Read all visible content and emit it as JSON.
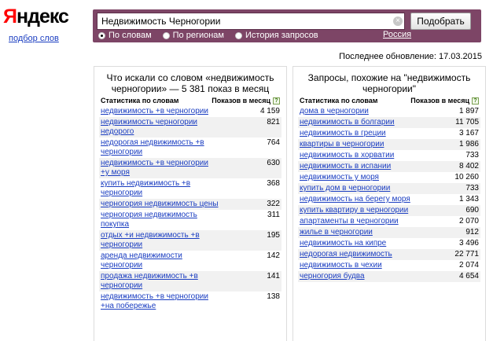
{
  "logo": {
    "first_letter": "Я",
    "rest": "ндекс"
  },
  "service_link": "подбор слов",
  "search": {
    "value": "Недвижимость Черногории",
    "placeholder": "",
    "submit_label": "Подобрать",
    "modes": [
      {
        "label": "По словам",
        "checked": true
      },
      {
        "label": "По регионам",
        "checked": false
      },
      {
        "label": "История запросов",
        "checked": false
      }
    ],
    "region_label": "Россия"
  },
  "updated": "Последнее обновление: 17.03.2015",
  "left_panel": {
    "title": "Что искали со словом «недвижимость черногории» — 5 381 показ в месяц",
    "col_query": "Статистика по словам",
    "col_shows": "Показов в месяц",
    "help_icon": "?",
    "rows": [
      {
        "query": "недвижимость +в черногории",
        "count": "4 159"
      },
      {
        "query": "недвижимость черногории недорого",
        "count": "821"
      },
      {
        "query": "недорогая недвижимость +в черногории",
        "count": "764"
      },
      {
        "query": "недвижимость +в черногории +у моря",
        "count": "630"
      },
      {
        "query": "купить недвижимость +в черногории",
        "count": "368"
      },
      {
        "query": "черногория недвижимость цены",
        "count": "322"
      },
      {
        "query": "черногория недвижимость покупка",
        "count": "311"
      },
      {
        "query": "отдых +и недвижимость +в черногории",
        "count": "195"
      },
      {
        "query": "аренда недвижимости черногории",
        "count": "142"
      },
      {
        "query": "продажа недвижимость +в черногории",
        "count": "141"
      },
      {
        "query": "недвижимость +в черногории +на побережье",
        "count": "138"
      }
    ]
  },
  "right_panel": {
    "title": "Запросы, похожие на \"недвижимость черногории\"",
    "col_query": "Статистика по словам",
    "col_shows": "Показов в месяц",
    "help_icon": "?",
    "rows": [
      {
        "query": "дома в черногории",
        "count": "1 897"
      },
      {
        "query": "недвижимость в болгарии",
        "count": "11 705"
      },
      {
        "query": "недвижимость в греции",
        "count": "3 167"
      },
      {
        "query": "квартиры в черногории",
        "count": "1 986"
      },
      {
        "query": "недвижимость в хорватии",
        "count": "733"
      },
      {
        "query": "недвижимость в испании",
        "count": "8 402"
      },
      {
        "query": "недвижимость у моря",
        "count": "10 260"
      },
      {
        "query": "купить дом в черногории",
        "count": "733"
      },
      {
        "query": "недвижимость на берегу моря",
        "count": "1 343"
      },
      {
        "query": "купить квартиру в черногории",
        "count": "690"
      },
      {
        "query": "апартаменты в черногории",
        "count": "2 070"
      },
      {
        "query": "жилье в черногории",
        "count": "912"
      },
      {
        "query": "недвижимость на кипре",
        "count": "3 496"
      },
      {
        "query": "недорогая недвижимость",
        "count": "22 771"
      },
      {
        "query": "недвижимость в чехии",
        "count": "2 074"
      },
      {
        "query": "черногория будва",
        "count": "4 654"
      }
    ]
  },
  "colors": {
    "accent": "#7d4566",
    "link": "#1a3dc1",
    "logo_red": "#ff0000"
  }
}
